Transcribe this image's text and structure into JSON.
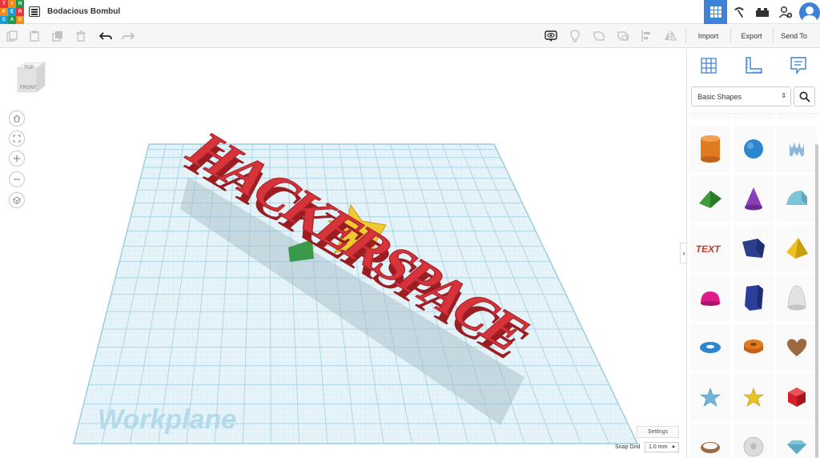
{
  "app": {
    "logo_letters": [
      "T",
      "I",
      "N",
      "K",
      "E",
      "R",
      "C",
      "A",
      "D"
    ],
    "title": "Bodacious Bombul"
  },
  "header": {
    "modes": [
      {
        "icon": "3d-design-grid-icon",
        "active": true
      },
      {
        "icon": "codeblocks-pickaxe-icon",
        "active": false
      },
      {
        "icon": "bricks-icon",
        "active": false
      },
      {
        "icon": "add-user-icon",
        "active": false
      },
      {
        "icon": "avatar",
        "active": false
      }
    ]
  },
  "toolbar": {
    "edit_tools": [
      "copy-icon",
      "paste-icon",
      "duplicate-icon",
      "delete-icon",
      "undo-icon",
      "redo-icon"
    ],
    "view_tools": [
      "notes-visibility-icon",
      "light-bulb-icon",
      "shape-outline-icon",
      "hole-shape-icon",
      "align-icon",
      "mirror-icon"
    ],
    "import_label": "Import",
    "export_label": "Export",
    "sendto_label": "Send To"
  },
  "viewport": {
    "viewcube": {
      "top_label": "TOP",
      "front_label": "FRONT"
    },
    "nav_buttons": [
      "home-icon",
      "fit-view-icon",
      "zoom-in-icon",
      "zoom-out-icon",
      "perspective-icon"
    ],
    "scene": {
      "text_object": "HACKERSPACE",
      "text_color": "#d6333a",
      "star_color": "#f0c834",
      "green_object_color": "#3a9a4a",
      "grid_color": "#b6dbe9"
    },
    "workplane_label": "Workplane",
    "settings_label": "Settings",
    "snap_grid_label": "Snap Grid",
    "snap_grid_value": "1.0 mm"
  },
  "panel": {
    "tabs": [
      "workplane-grid-icon",
      "ruler-icon",
      "notes-icon"
    ],
    "library_selected": "Basic Shapes",
    "shapes": [
      {
        "name": "cylinder",
        "color": "#e07b1f"
      },
      {
        "name": "sphere",
        "color": "#2b86cf"
      },
      {
        "name": "scribble",
        "color": "#8bb8df"
      },
      {
        "name": "roof",
        "color": "#3e9b3a"
      },
      {
        "name": "cone",
        "color": "#8a3eb8"
      },
      {
        "name": "round-roof",
        "color": "#7ec3d6"
      },
      {
        "name": "text",
        "color": "#d03a2e"
      },
      {
        "name": "box-wedge",
        "color": "#2c3f8f"
      },
      {
        "name": "pyramid",
        "color": "#f0c21e"
      },
      {
        "name": "half-sphere",
        "color": "#df1d8a"
      },
      {
        "name": "polygon",
        "color": "#2b3f9a"
      },
      {
        "name": "paraboloid",
        "color": "#d8d8d8"
      },
      {
        "name": "torus",
        "color": "#2b86cf"
      },
      {
        "name": "tube",
        "color": "#e07b1f"
      },
      {
        "name": "heart",
        "color": "#9c6a42"
      },
      {
        "name": "star-blue",
        "color": "#6fb4d9"
      },
      {
        "name": "star-yellow",
        "color": "#e8c320"
      },
      {
        "name": "icosahedron",
        "color": "#d3202a"
      },
      {
        "name": "ring",
        "color": "#9c6a42"
      },
      {
        "name": "soccer-ball",
        "color": "#d8d8d8"
      },
      {
        "name": "gem",
        "color": "#7fc4d9"
      }
    ]
  }
}
